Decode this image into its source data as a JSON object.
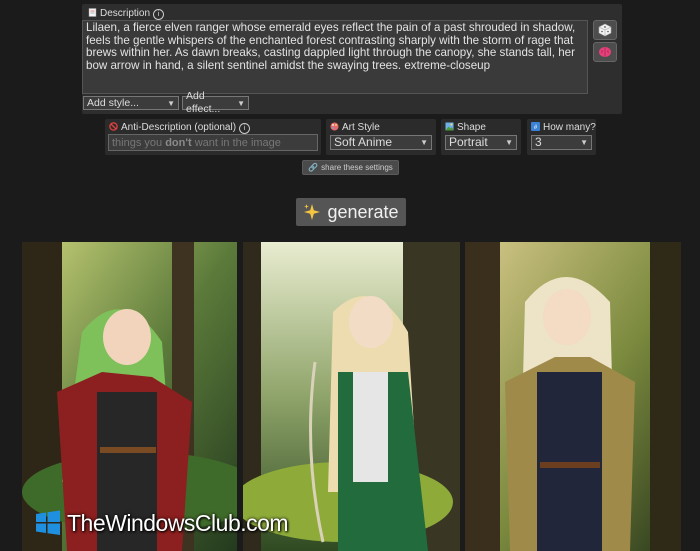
{
  "description": {
    "label": "Description",
    "info_glyph": "i",
    "text": "Lilaen, a fierce elven ranger whose emerald eyes reflect the pain of a past shrouded in shadow, feels the gentle whispers of the enchanted forest contrasting sharply with the storm of rage that brews within her. As dawn breaks, casting dappled light through the canopy, she stands tall, her bow arrow in hand, a silent sentinel amidst the swaying trees. extreme-closeup",
    "add_style": "Add style...",
    "add_effect": "Add effect...",
    "side_buttons": [
      "dice-icon",
      "brain-icon"
    ]
  },
  "anti_description": {
    "label": "Anti-Description (optional)",
    "placeholder_pre": "things you ",
    "placeholder_bold": "don't",
    "placeholder_post": " want in the image"
  },
  "art_style": {
    "label": "Art Style",
    "value": "Soft Anime"
  },
  "shape": {
    "label": "Shape",
    "value": "Portrait"
  },
  "count": {
    "label": "How many?",
    "value": "3"
  },
  "share_button": "share these settings",
  "generate_button": "generate",
  "generate_icon": "sparkles-icon",
  "watermark": "TheWindowsClub.com",
  "colors": {
    "background": "#1b1b1b",
    "panel": "#2b2b2b",
    "button": "#555555",
    "accent_pink": "#e5407a"
  }
}
